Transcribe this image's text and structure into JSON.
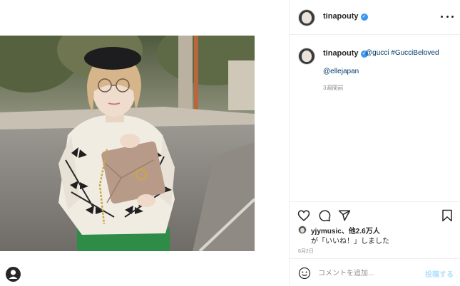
{
  "post": {
    "username": "tinapouty",
    "verified_symbol": "✓",
    "caption": {
      "mention": "@gucci",
      "hashtag": "#GucciBeloved",
      "second_mention": "@ellejapan"
    },
    "time_ago": "3週間前",
    "likes": {
      "liker": "yjymusic",
      "others_text": "、他2.6万人",
      "suffix": "が「いいね！」しました"
    },
    "date": "6月2日"
  },
  "comment": {
    "placeholder": "コメントを追加...",
    "post_label": "投稿する"
  },
  "icons": {
    "more": "more-options-icon",
    "like": "heart-icon",
    "comment": "comment-icon",
    "share": "share-icon",
    "save": "bookmark-icon",
    "emoji": "emoji-icon",
    "profile": "profile-icon"
  },
  "colors": {
    "link": "#00376b",
    "verified": "#3897f0",
    "post_button_disabled": "#b2dffc",
    "muted": "#8e8e8e"
  }
}
